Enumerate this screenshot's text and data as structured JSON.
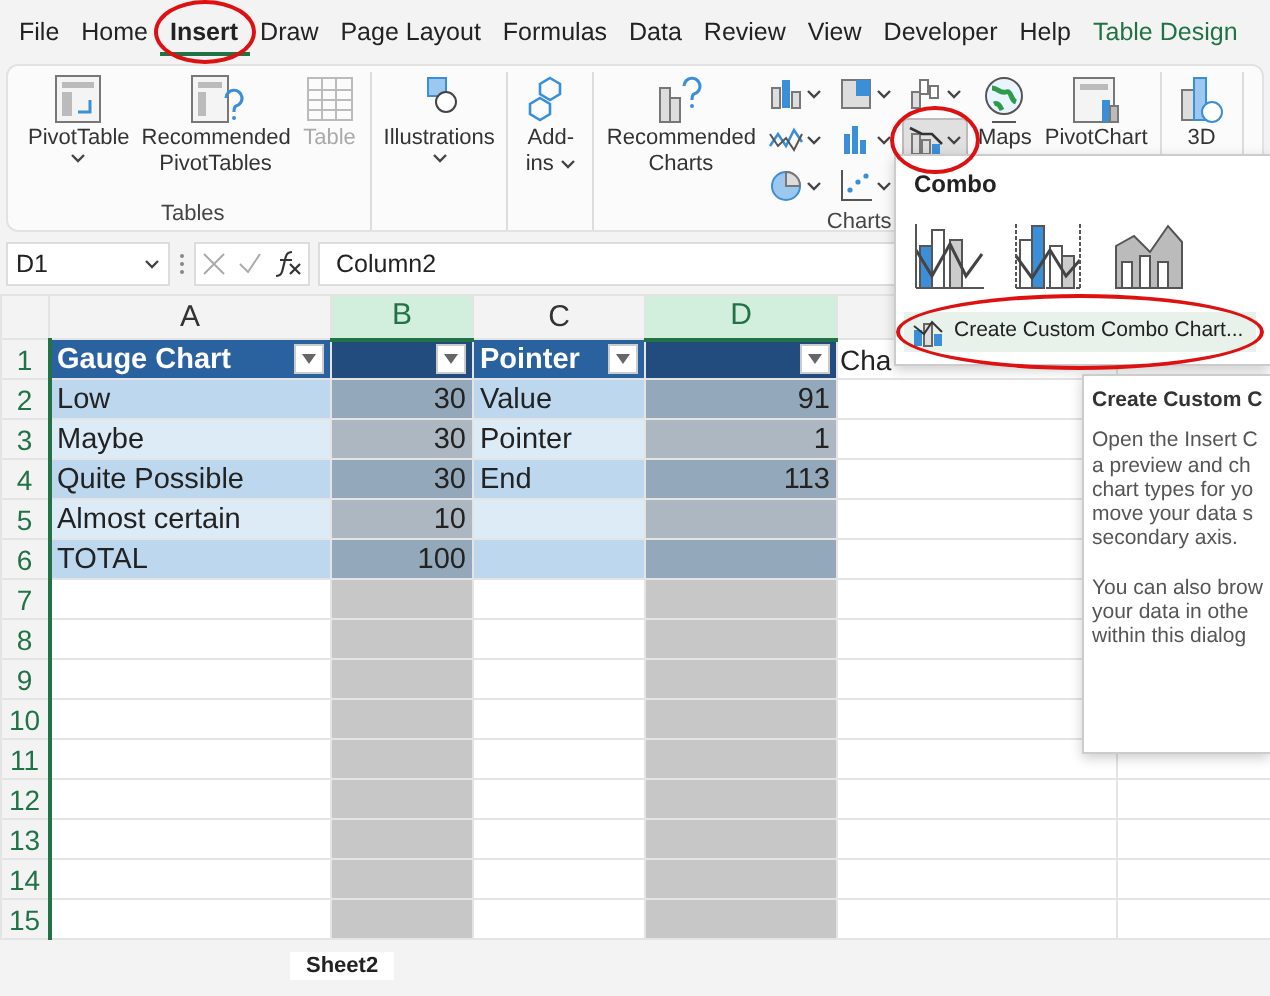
{
  "menu_tabs": [
    {
      "label": "File",
      "selected": false,
      "circled": false,
      "kind": "normal"
    },
    {
      "label": "Home",
      "selected": false,
      "circled": false,
      "kind": "normal"
    },
    {
      "label": "Insert",
      "selected": true,
      "circled": true,
      "kind": "normal"
    },
    {
      "label": "Draw",
      "selected": false,
      "circled": false,
      "kind": "normal"
    },
    {
      "label": "Page Layout",
      "selected": false,
      "circled": false,
      "kind": "normal"
    },
    {
      "label": "Formulas",
      "selected": false,
      "circled": false,
      "kind": "normal"
    },
    {
      "label": "Data",
      "selected": false,
      "circled": false,
      "kind": "normal"
    },
    {
      "label": "Review",
      "selected": false,
      "circled": false,
      "kind": "normal"
    },
    {
      "label": "View",
      "selected": false,
      "circled": false,
      "kind": "normal"
    },
    {
      "label": "Developer",
      "selected": false,
      "circled": false,
      "kind": "normal"
    },
    {
      "label": "Help",
      "selected": false,
      "circled": false,
      "kind": "normal"
    },
    {
      "label": "Table Design",
      "selected": false,
      "circled": false,
      "kind": "contextual"
    }
  ],
  "ribbon": {
    "groups": [
      {
        "label": "Tables",
        "buttons": [
          {
            "kind": "pivottable",
            "label": "PivotTable",
            "dropdown": true,
            "disabled": false
          },
          {
            "kind": "recommended_pivot",
            "label": "Recommended PivotTables",
            "dropdown": false,
            "disabled": false
          },
          {
            "kind": "table",
            "label": "Table",
            "dropdown": false,
            "disabled": true
          }
        ]
      },
      {
        "buttons": [
          {
            "kind": "illustrations",
            "label": "Illustrations",
            "dropdown": true,
            "disabled": false
          }
        ]
      },
      {
        "buttons": [
          {
            "kind": "addins",
            "label": "Add-ins",
            "dropdown": true,
            "disabled": false
          }
        ]
      },
      {
        "label": "Charts",
        "buttons": [
          {
            "kind": "recommended_charts",
            "label": "Recommended Charts",
            "dropdown": false,
            "disabled": false
          },
          {
            "kind": "maps",
            "label": "Maps",
            "disabled": false
          },
          {
            "kind": "pivotchart",
            "label": "PivotChart",
            "disabled": false
          }
        ],
        "chart_types": [
          {
            "kind": "column",
            "pressed": false,
            "circled": false
          },
          {
            "kind": "hierarchy",
            "pressed": false,
            "circled": false
          },
          {
            "kind": "waterfall",
            "pressed": false,
            "circled": false
          },
          {
            "kind": "line",
            "pressed": false,
            "circled": false
          },
          {
            "kind": "statistic",
            "pressed": false,
            "circled": false
          },
          {
            "kind": "combo",
            "pressed": true,
            "circled": true
          },
          {
            "kind": "pie",
            "pressed": false,
            "circled": false
          },
          {
            "kind": "scatter",
            "pressed": false,
            "circled": false
          }
        ]
      },
      {
        "buttons": [
          {
            "kind": "map3d",
            "label": "3D",
            "disabled": false
          }
        ]
      }
    ]
  },
  "combo_menu": {
    "title": "Combo",
    "thumbnails": [
      {
        "kind": "column_line"
      },
      {
        "kind": "column_line_secondary"
      },
      {
        "kind": "area_column"
      }
    ],
    "item": {
      "label": "Create Custom Combo Chart...",
      "hovered": true,
      "circled": true
    }
  },
  "tooltip": {
    "title": "Create Custom C",
    "paragraphs": [
      [
        "Open the Insert C",
        "a preview and ch",
        "chart types for yo",
        "move your data s",
        "secondary axis."
      ],
      [
        "You can also brow",
        "your data in othe",
        "within this dialog"
      ]
    ]
  },
  "formula_bar": {
    "name_box": "D1",
    "formula": "Column2"
  },
  "sheet": {
    "columns": [
      {
        "label": "A",
        "selected": false
      },
      {
        "label": "B",
        "selected": true
      },
      {
        "label": "C",
        "selected": false
      },
      {
        "label": "D",
        "selected": true
      }
    ],
    "rows": [
      {
        "number": "1",
        "kind": "header",
        "cells": [
          {
            "text": "Gauge Chart",
            "filter": true
          },
          {
            "filter": true
          },
          {
            "text": "Pointer",
            "filter": true
          },
          {
            "filter": true
          },
          {
            "text": "Cha"
          }
        ]
      },
      {
        "number": "2",
        "kind": "band_dark",
        "cells": [
          {
            "text": "Low"
          },
          {
            "text": "30",
            "numeric": true
          },
          {
            "text": "Value"
          },
          {
            "text": "91",
            "numeric": true
          }
        ]
      },
      {
        "number": "3",
        "kind": "band_light",
        "cells": [
          {
            "text": "Maybe"
          },
          {
            "text": "30",
            "numeric": true
          },
          {
            "text": "Pointer"
          },
          {
            "text": "1",
            "numeric": true
          }
        ]
      },
      {
        "number": "4",
        "kind": "band_dark",
        "cells": [
          {
            "text": "Quite Possible"
          },
          {
            "text": "30",
            "numeric": true
          },
          {
            "text": "End"
          },
          {
            "text": "113",
            "numeric": true
          }
        ]
      },
      {
        "number": "5",
        "kind": "band_light",
        "cells": [
          {
            "text": "Almost certain"
          },
          {
            "text": "10",
            "numeric": true
          },
          {},
          {}
        ]
      },
      {
        "number": "6",
        "kind": "band_dark",
        "cells": [
          {
            "text": "TOTAL"
          },
          {
            "text": "100",
            "numeric": true
          },
          {},
          {}
        ]
      },
      {
        "number": "7",
        "kind": "empty"
      },
      {
        "number": "8",
        "kind": "empty"
      },
      {
        "number": "9",
        "kind": "empty"
      },
      {
        "number": "10",
        "kind": "empty"
      },
      {
        "number": "11",
        "kind": "empty"
      },
      {
        "number": "12",
        "kind": "empty"
      },
      {
        "number": "13",
        "kind": "empty"
      },
      {
        "number": "14",
        "kind": "empty"
      },
      {
        "number": "15",
        "kind": "empty"
      }
    ]
  },
  "sheet_tabs": [
    {
      "label": "Sheet2",
      "selected": true
    }
  ]
}
